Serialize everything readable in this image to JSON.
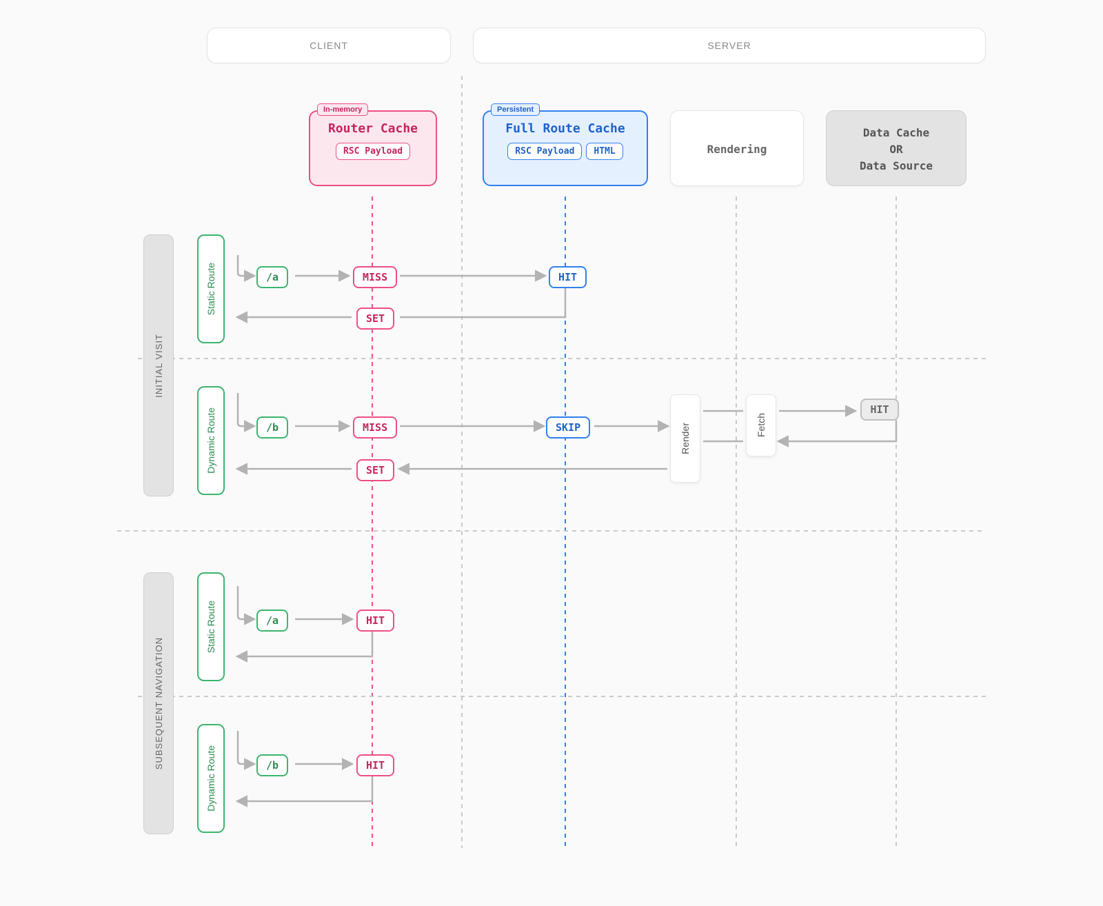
{
  "headers": {
    "client": "CLIENT",
    "server": "SERVER"
  },
  "columns": {
    "router": {
      "tab": "In-memory",
      "title": "Router Cache",
      "chips": [
        "RSC Payload"
      ]
    },
    "full": {
      "tab": "Persistent",
      "title": "Full Route Cache",
      "chips": [
        "RSC Payload",
        "HTML"
      ]
    },
    "render": {
      "title": "Rendering"
    },
    "data": {
      "title": "Data Cache\nOR\nData Source"
    }
  },
  "sections": {
    "initial": {
      "label": "INITIAL VISIT"
    },
    "subsequent": {
      "label": "SUBSEQUENT NAVIGATION"
    }
  },
  "routes": {
    "static_label": "Static Route",
    "dynamic_label": "Dynamic Route"
  },
  "flow": {
    "initial_static": {
      "path": "/a",
      "router": "MISS",
      "full": "HIT",
      "set": "SET"
    },
    "initial_dynamic": {
      "path": "/b",
      "router": "MISS",
      "full": "SKIP",
      "set": "SET",
      "render": "Render",
      "fetch": "Fetch",
      "data": "HIT"
    },
    "sub_static": {
      "path": "/a",
      "router": "HIT"
    },
    "sub_dynamic": {
      "path": "/b",
      "router": "HIT"
    }
  }
}
